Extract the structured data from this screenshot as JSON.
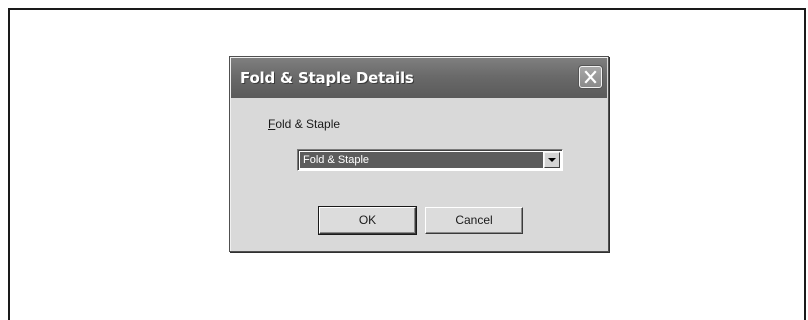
{
  "dialog": {
    "title": "Fold & Staple Details",
    "close_icon": "close-icon"
  },
  "fold_staple": {
    "label_mnemonic": "F",
    "label_rest": "old & Staple",
    "selected_value": "Fold & Staple",
    "dropdown_icon": "chevron-down-icon"
  },
  "buttons": {
    "ok_label": "OK",
    "cancel_label": "Cancel"
  },
  "colors": {
    "title_bar": "#6a6a6a",
    "dialog_face": "#d9d9d9",
    "selection": "#5c5c5c"
  }
}
